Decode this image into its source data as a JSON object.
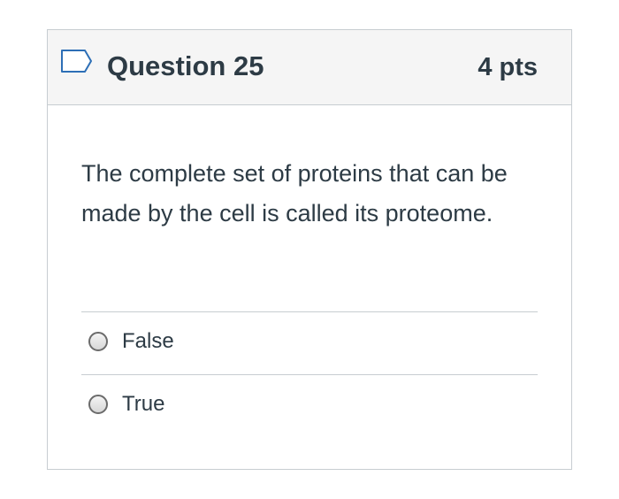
{
  "question": {
    "title": "Question 25",
    "points": "4 pts",
    "flag_icon": "flag-bookmark-icon",
    "text": "The complete set of proteins that can be made by the cell is called its proteome."
  },
  "answers": [
    {
      "label": "False",
      "selected": false
    },
    {
      "label": "True",
      "selected": false
    }
  ],
  "colors": {
    "text": "#2d3b45",
    "border": "#c7cdd1",
    "header_bg": "#f5f5f5",
    "flag_outline": "#2d6fb6"
  }
}
